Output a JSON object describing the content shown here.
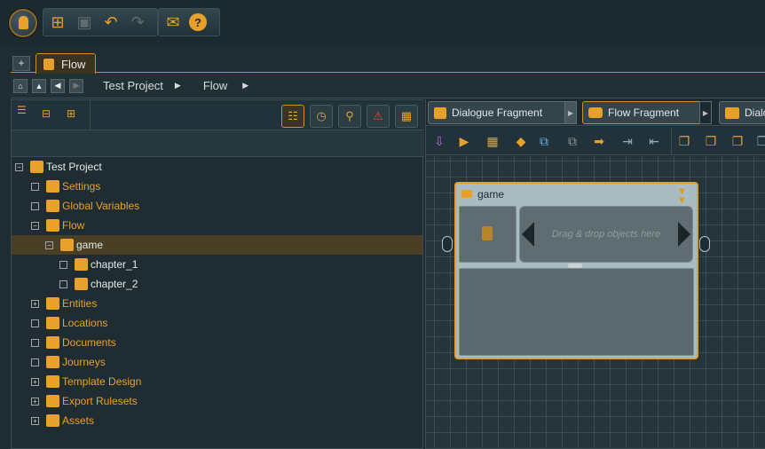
{
  "toolbar": {
    "buttons": [
      {
        "name": "new-icon",
        "glyph": "⊞"
      },
      {
        "name": "save-icon",
        "glyph": "▣"
      },
      {
        "name": "undo-icon",
        "glyph": "↶"
      },
      {
        "name": "redo-icon",
        "glyph": "↷"
      },
      {
        "name": "mail-icon",
        "glyph": "✉"
      },
      {
        "name": "help-icon",
        "glyph": "?"
      }
    ]
  },
  "tabs": {
    "add": "+",
    "active": "Flow"
  },
  "breadcrumb": {
    "items": [
      "Test Project",
      "Flow"
    ]
  },
  "tree": [
    {
      "label": "Test Project",
      "level": 0,
      "expander": "−",
      "color": "#e4e8ea",
      "icon": "project-icon"
    },
    {
      "label": "Settings",
      "level": 1,
      "expander": "",
      "color": "#e8a12a",
      "icon": "gear-icon"
    },
    {
      "label": "Global Variables",
      "level": 1,
      "expander": "",
      "color": "#e8a12a",
      "icon": "variables-icon"
    },
    {
      "label": "Flow",
      "level": 1,
      "expander": "−",
      "color": "#e8a12a",
      "icon": "flow-folder-icon"
    },
    {
      "label": "game",
      "level": 2,
      "expander": "−",
      "color": "#e4e8ea",
      "icon": "flow-fragment-icon"
    },
    {
      "label": "chapter_1",
      "level": 3,
      "expander": "",
      "color": "#e4e8ea",
      "icon": "flow-fragment-icon"
    },
    {
      "label": "chapter_2",
      "level": 3,
      "expander": "",
      "color": "#e4e8ea",
      "icon": "flow-fragment-icon"
    },
    {
      "label": "Entities",
      "level": 1,
      "expander": "+",
      "color": "#e8a12a",
      "icon": "entities-icon"
    },
    {
      "label": "Locations",
      "level": 1,
      "expander": "",
      "color": "#e8a12a",
      "icon": "locations-icon"
    },
    {
      "label": "Documents",
      "level": 1,
      "expander": "",
      "color": "#e8a12a",
      "icon": "documents-icon"
    },
    {
      "label": "Journeys",
      "level": 1,
      "expander": "",
      "color": "#e8a12a",
      "icon": "journeys-icon"
    },
    {
      "label": "Template Design",
      "level": 1,
      "expander": "+",
      "color": "#e8a12a",
      "icon": "template-icon"
    },
    {
      "label": "Export Rulesets",
      "level": 1,
      "expander": "+",
      "color": "#e8a12a",
      "icon": "export-icon"
    },
    {
      "label": "Assets",
      "level": 1,
      "expander": "+",
      "color": "#e8a12a",
      "icon": "assets-icon"
    }
  ],
  "palette_tabs": [
    {
      "label": "Dialogue Fragment"
    },
    {
      "label": "Flow Fragment"
    },
    {
      "label": "Dialo"
    }
  ],
  "node": {
    "title": "game",
    "drop_hint": "Drag & drop objects here"
  },
  "colors": {
    "accent": "#e8a12a",
    "background": "#1f2d33",
    "selection": "#4a3e24"
  }
}
